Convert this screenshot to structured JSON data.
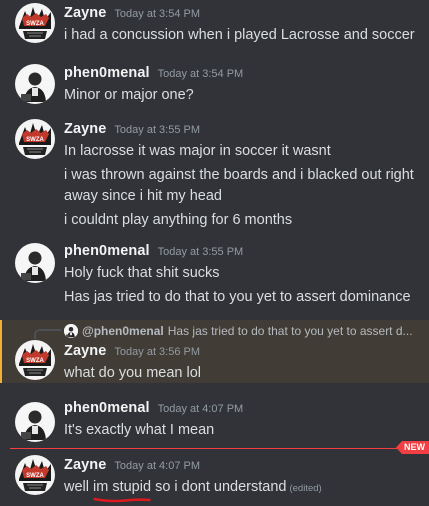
{
  "messages": [
    {
      "user": "Zayne",
      "time": "Today at 3:54 PM",
      "lines": [
        "i had a concussion when i played Lacrosse and soccer"
      ]
    },
    {
      "user": "phen0menal",
      "time": "Today at 3:54 PM",
      "lines": [
        "Minor or major one?"
      ]
    },
    {
      "user": "Zayne",
      "time": "Today at 3:55 PM",
      "lines": [
        "In lacrosse it was major in soccer it wasnt",
        "i was thrown against the boards and i blacked out right away since i hit my head",
        "i couldnt play anything for 6 months"
      ]
    },
    {
      "user": "phen0menal",
      "time": "Today at 3:55 PM",
      "lines": [
        "Holy fuck that shit sucks",
        "Has jas tried to do that to you yet to assert dominance"
      ]
    },
    {
      "user": "Zayne",
      "time": "Today at 3:56 PM",
      "lines": [
        "what do you mean lol"
      ],
      "reply": {
        "user": "@phen0menal",
        "text": "Has jas tried to do that to you yet to assert d..."
      }
    },
    {
      "user": "phen0menal",
      "time": "Today at 4:07 PM",
      "lines": [
        "It's exactly what I mean"
      ]
    },
    {
      "user": "Zayne",
      "time": "Today at 4:07 PM",
      "parts": {
        "a": "well ",
        "b": "im stupid",
        "c": " so i dont understand"
      },
      "edited": "(edited)"
    }
  ],
  "new_badge": "NEW",
  "colors": {
    "accent_new": "#f23f43",
    "reply_highlight": "#f0b232",
    "background": "#313338"
  }
}
